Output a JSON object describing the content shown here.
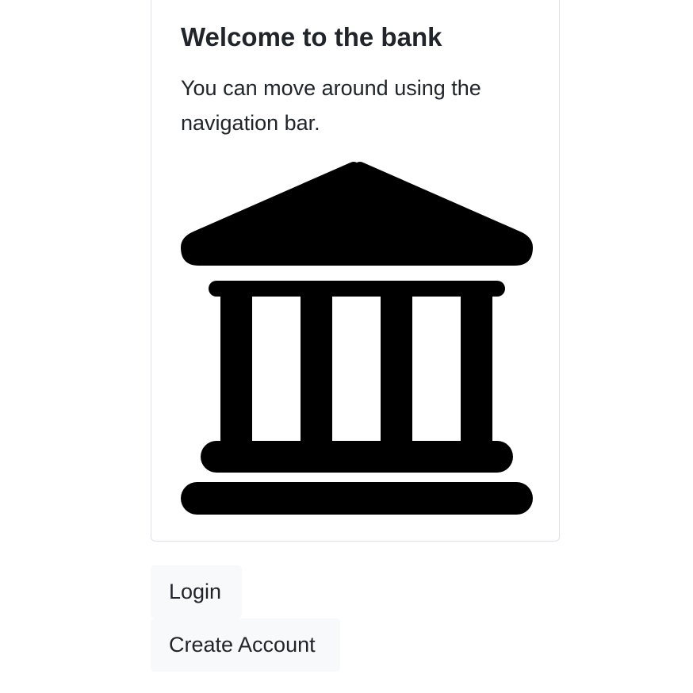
{
  "welcome_card": {
    "title": "Welcome to the bank",
    "text": "You can move around using the navigation bar.",
    "icon": "bank-icon"
  },
  "actions": {
    "login_label": "Login",
    "create_account_label": "Create Account"
  }
}
